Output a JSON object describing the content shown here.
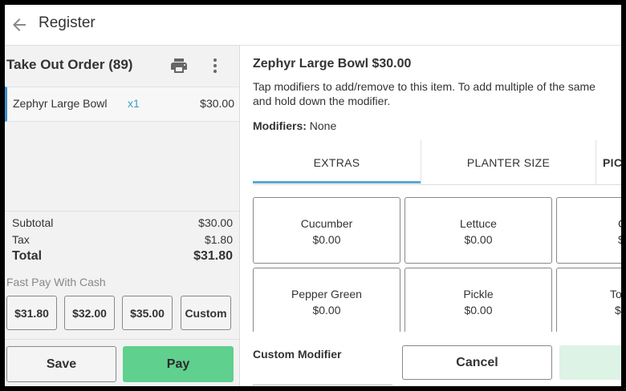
{
  "app": {
    "title": "Register"
  },
  "order": {
    "title": "Take Out Order (89)",
    "items": [
      {
        "name": "Zephyr Large Bowl",
        "qty": "x1",
        "price": "$30.00"
      }
    ],
    "subtotal_label": "Subtotal",
    "subtotal": "$30.00",
    "tax_label": "Tax",
    "tax": "$1.80",
    "total_label": "Total",
    "total": "$31.80",
    "fast_pay_label": "Fast Pay With Cash",
    "cash_options": [
      "$31.80",
      "$32.00",
      "$35.00",
      "Custom"
    ],
    "save_label": "Save",
    "pay_label": "Pay"
  },
  "item_detail": {
    "title": "Zephyr Large Bowl $30.00",
    "instructions_line1": "Tap modifiers to add/remove to this item. To add multiple of the same",
    "instructions_line2": "and hold down the modifier.",
    "modifiers_label": "Modifiers:",
    "modifiers_value": "None",
    "tabs": [
      "EXTRAS",
      "PLANTER SIZE",
      "PIC"
    ],
    "active_tab": "EXTRAS",
    "modifier_cards": [
      {
        "name": "Cucumber",
        "price": "$0.00"
      },
      {
        "name": "Lettuce",
        "price": "$0.00"
      },
      {
        "name": "C",
        "price": "$"
      },
      {
        "name": "Pepper Green",
        "price": "$0.00"
      },
      {
        "name": "Pickle",
        "price": "$0.00"
      },
      {
        "name": "To",
        "price": "$"
      }
    ],
    "custom_modifier_label": "Custom Modifier",
    "cancel_label": "Cancel"
  },
  "colors": {
    "accent": "#5aa8d6",
    "pay": "#5fd08e",
    "qty": "#3a9fc9"
  },
  "icons": {
    "back": "arrow-left-icon",
    "print": "printer-icon",
    "more": "more-vert-icon"
  }
}
